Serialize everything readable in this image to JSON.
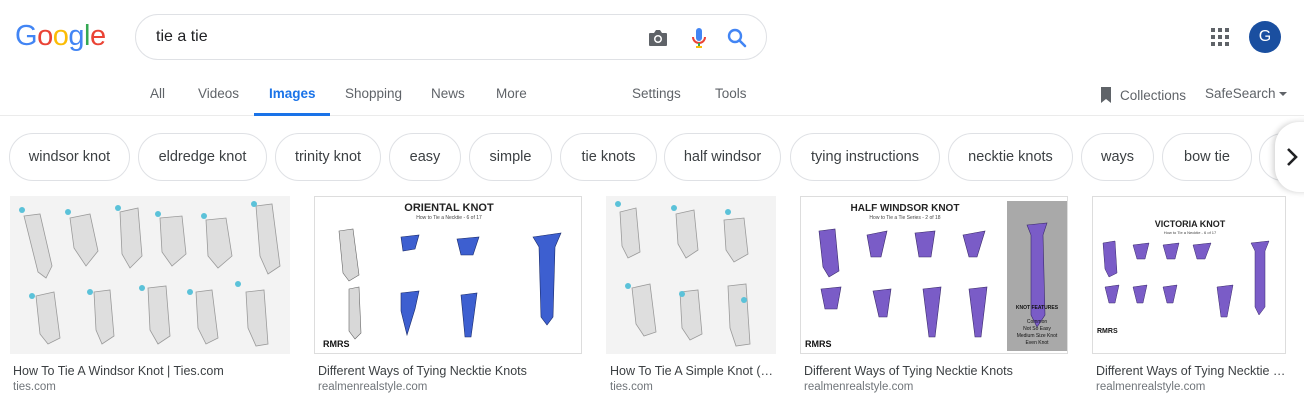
{
  "logo": {
    "letters": [
      "G",
      "o",
      "o",
      "g",
      "l",
      "e"
    ],
    "colors": [
      "#4285F4",
      "#EA4335",
      "#FBBC05",
      "#4285F4",
      "#34A853",
      "#EA4335"
    ]
  },
  "search": {
    "value": "tie a tie",
    "camera_icon": "camera-icon",
    "mic_icon": "mic-icon",
    "search_icon": "search-icon"
  },
  "account": {
    "initial": "G",
    "color": "#1a4fa0"
  },
  "tabs": [
    {
      "label": "All"
    },
    {
      "label": "Videos"
    },
    {
      "label": "Images",
      "active": true
    },
    {
      "label": "Shopping"
    },
    {
      "label": "News"
    },
    {
      "label": "More"
    },
    {
      "label": "Settings"
    },
    {
      "label": "Tools"
    }
  ],
  "tools": {
    "collections": "Collections",
    "safesearch": "SafeSearch"
  },
  "chips": [
    "windsor knot",
    "eldredge knot",
    "trinity knot",
    "easy",
    "simple",
    "tie knots",
    "half windsor",
    "tying instructions",
    "necktie knots",
    "ways",
    "bow tie"
  ],
  "results": [
    {
      "title": "How To Tie A Windsor Knot | Ties.com",
      "source": "ties.com"
    },
    {
      "title": "Different Ways of Tying Necktie Knots",
      "source": "realmenrealstyle.com",
      "poster_title": "ORIENTAL KNOT",
      "poster_sub": "How to Tie a Necktie - 6 of 17",
      "brand": "RMRS"
    },
    {
      "title": "How To Tie A Simple Knot (…",
      "source": "ties.com"
    },
    {
      "title": "Different Ways of Tying Necktie Knots",
      "source": "realmenrealstyle.com",
      "poster_title": "HALF WINDSOR KNOT",
      "poster_sub": "How to Tie a Tie Series - 2 of 18",
      "brand": "RMRS",
      "features_title": "KNOT FEATURES",
      "features": [
        "Common",
        "Not So Easy",
        "Medium Size Knot",
        "Even Knot"
      ]
    },
    {
      "title": "Different Ways of Tying Necktie …",
      "source": "realmenrealstyle.com",
      "poster_title": "VICTORIA KNOT",
      "poster_sub": "How to Tie a Necktie - 6 of 17",
      "brand": "RMRS"
    }
  ],
  "colors": {
    "accent": "#1a73e8",
    "tie_purple": "#7a5cc7",
    "tie_blue": "#2a4fc9",
    "tie_gray": "#dcdcdc"
  }
}
